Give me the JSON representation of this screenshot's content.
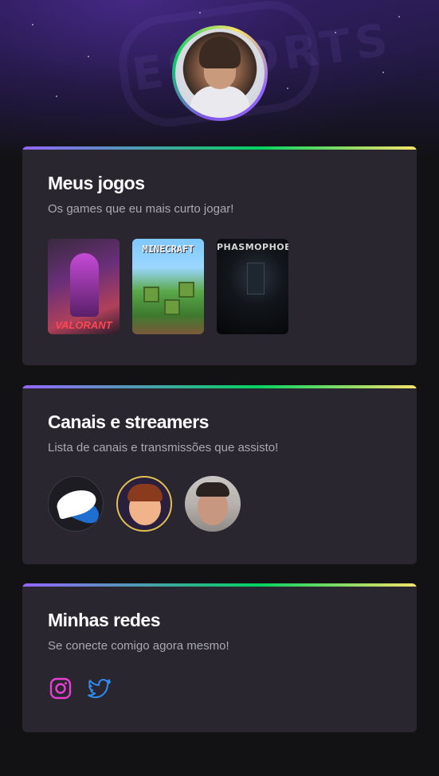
{
  "profile": {
    "avatar_icon": "user-avatar"
  },
  "colors": {
    "background": "#121214",
    "card": "#29262f",
    "accent_purple": "#9466ff",
    "accent_green": "#04d361",
    "accent_yellow": "#f7e26b",
    "instagram": "#e93fd2",
    "twitter": "#2d8cf0"
  },
  "games_section": {
    "title": "Meus jogos",
    "subtitle": "Os games que eu mais curto jogar!",
    "games": [
      {
        "name": "VALORANT",
        "icon": "valorant-cover"
      },
      {
        "name": "MINECRAFT",
        "icon": "minecraft-cover"
      },
      {
        "name": "PHASMOPHOBIA",
        "icon": "phasmophobia-cover"
      }
    ]
  },
  "streamers_section": {
    "title": "Canais e streamers",
    "subtitle": "Lista de canais e transmissões que assisto!",
    "streamers": [
      {
        "icon": "winged-shoe-avatar"
      },
      {
        "icon": "cartoon-avatar"
      },
      {
        "icon": "streamer-photo-avatar"
      }
    ]
  },
  "social_section": {
    "title": "Minhas redes",
    "subtitle": "Se conecte comigo agora mesmo!",
    "links": [
      {
        "icon": "instagram-icon"
      },
      {
        "icon": "twitter-icon"
      }
    ]
  }
}
